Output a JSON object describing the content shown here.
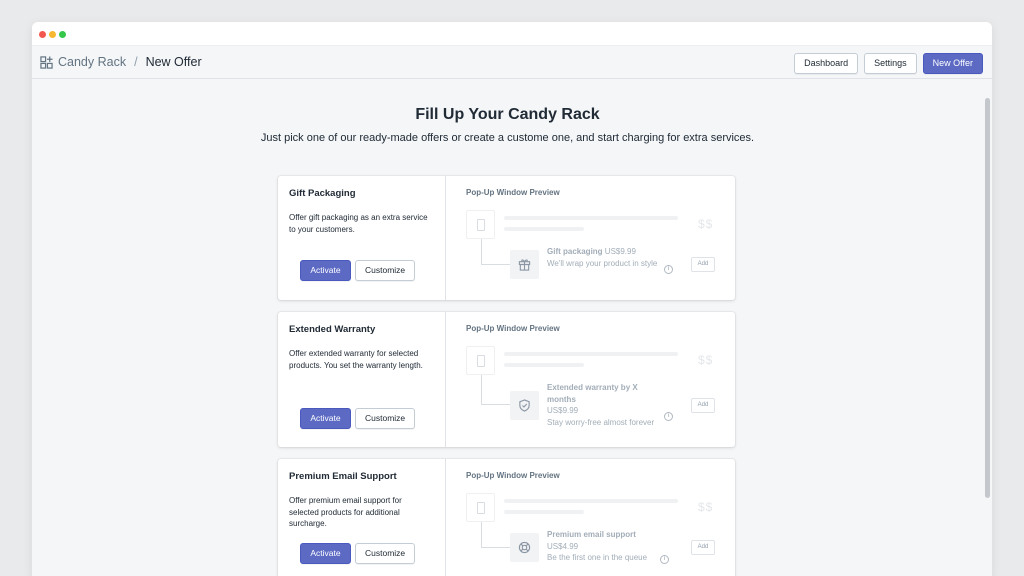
{
  "window": {
    "controls": [
      "close",
      "minimize",
      "maximize"
    ]
  },
  "breadcrumb": {
    "app_icon": "apps-grid-icon",
    "app_name": "Candy Rack",
    "separator": "/",
    "current": "New Offer"
  },
  "header_actions": {
    "dashboard": "Dashboard",
    "settings": "Settings",
    "new_offer": "New Offer"
  },
  "colors": {
    "primary": "#5c6ac4",
    "background": "#f4f6f8",
    "text": "#212b36"
  },
  "hero": {
    "title": "Fill Up Your Candy Rack",
    "subtitle": "Just pick one of our ready-made offers or create a custome one, and start charging for extra services."
  },
  "offers": [
    {
      "title": "Gift Packaging",
      "description": "Offer gift packaging as an extra service to your customers.",
      "activate": "Activate",
      "customize": "Customize",
      "preview_title": "Pop-Up Window Preview",
      "preview_icon": "gift-icon",
      "preview_name": "Gift packaging",
      "preview_price": "US$9.99",
      "preview_desc": "We'll wrap your product in style",
      "preview_price_placeholder": "$$",
      "preview_add": "Add"
    },
    {
      "title": "Extended Warranty",
      "description": "Offer extended warranty for selected products. You set the warranty length.",
      "activate": "Activate",
      "customize": "Customize",
      "preview_title": "Pop-Up Window Preview",
      "preview_icon": "shield-check-icon",
      "preview_name": "Extended warranty by X months",
      "preview_price": "US$9.99",
      "preview_desc": "Stay worry-free almost forever",
      "preview_price_placeholder": "$$",
      "preview_add": "Add"
    },
    {
      "title": "Premium Email Support",
      "description": "Offer premium email support for selected products for additional surcharge.",
      "activate": "Activate",
      "customize": "Customize",
      "preview_title": "Pop-Up Window Preview",
      "preview_icon": "lifebuoy-icon",
      "preview_name": "Premium email support",
      "preview_price": "US$4.99",
      "preview_desc": "Be the first one in the queue",
      "preview_price_placeholder": "$$",
      "preview_add": "Add"
    }
  ]
}
